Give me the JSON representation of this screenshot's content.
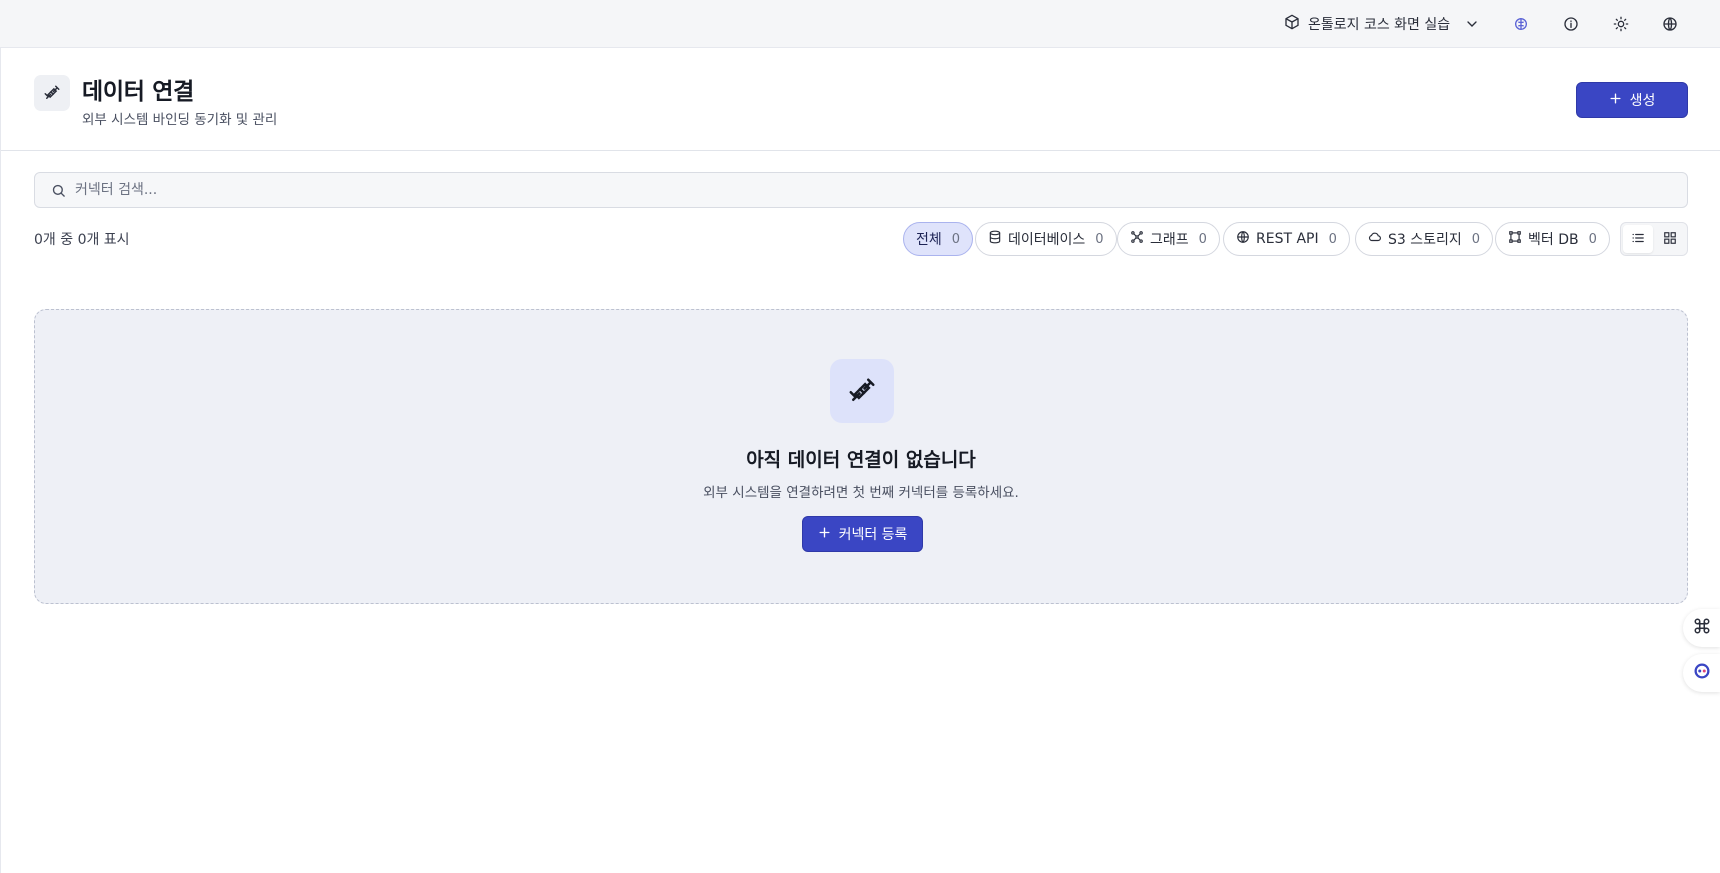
{
  "topbar": {
    "project_name": "온톨로지 코스 화면 실습",
    "icons": [
      "package-icon",
      "chevron-down-icon",
      "brain-icon",
      "info-icon",
      "sun-icon",
      "globe-icon"
    ]
  },
  "header": {
    "title": "데이터 연결",
    "subtitle": "외부 시스템 바인딩 동기화 및 관리",
    "create_label": "생성"
  },
  "search": {
    "placeholder": "커넥터 검색...",
    "value": ""
  },
  "results": {
    "count_text": "0개 중 0개 표시"
  },
  "filters": [
    {
      "label": "전체",
      "count": "0",
      "icon": "",
      "active": true
    },
    {
      "label": "데이터베이스",
      "count": "0",
      "icon": "database-icon",
      "active": false
    },
    {
      "label": "그래프",
      "count": "0",
      "icon": "graph-icon",
      "active": false
    },
    {
      "label": "REST API",
      "count": "0",
      "icon": "globe-icon",
      "active": false
    },
    {
      "label": "S3 스토리지",
      "count": "0",
      "icon": "cloud-icon",
      "active": false
    },
    {
      "label": "벡터 DB",
      "count": "0",
      "icon": "vector-icon",
      "active": false
    }
  ],
  "view": {
    "selected": "list"
  },
  "empty_state": {
    "title": "아직 데이터 연결이 없습니다",
    "description": "외부 시스템을 연결하려면 첫 번째 커넥터를 등록하세요.",
    "button_label": "커넥터 등록"
  },
  "colors": {
    "primary": "#3a46c4",
    "active_chip_bg": "#dfe3fb",
    "empty_bg": "#eef0f6"
  }
}
